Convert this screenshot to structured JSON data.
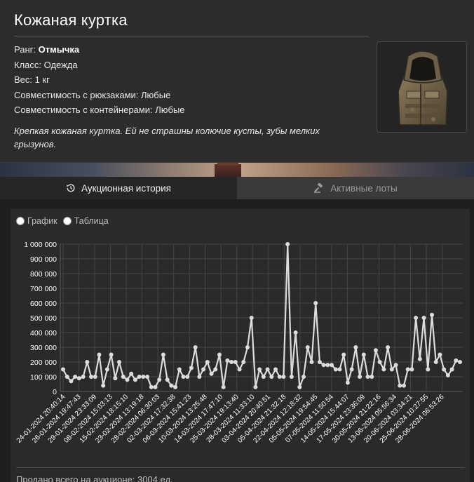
{
  "item": {
    "title": "Кожаная куртка",
    "rank_label": "Ранг: ",
    "rank_value": "Отмычка",
    "class_line": "Класс: Одежда",
    "weight_line": "Вес: 1 кг",
    "backpack_line": "Совместимость с рюкзаками: Любые",
    "container_line": "Совместимость с контейнерами: Любые",
    "description": "Крепкая кожаная куртка. Ей не страшны колючие кусты, зубы мелких грызунов.",
    "image_icon": "leather-jacket-hood-icon"
  },
  "tabs": [
    {
      "label": "Аукционная история",
      "icon": "history-icon",
      "active": true
    },
    {
      "label": "Активные лоты",
      "icon": "gavel-icon",
      "active": false
    }
  ],
  "view_options": {
    "graph_label": "График",
    "table_label": "Таблица"
  },
  "colors": {
    "line": "#dcdcdc",
    "grid": "#454545",
    "tick_text": "#ffffff"
  },
  "footer": {
    "sold_text": "Продано всего на аукционе: 3004 ед."
  },
  "chart_data": {
    "type": "line",
    "title": "",
    "xlabel": "",
    "ylabel": "",
    "ylim": [
      0,
      1000000
    ],
    "y_ticks": [
      "0",
      "100 000",
      "200 000",
      "300 000",
      "400 000",
      "500 000",
      "600 000",
      "700 000",
      "800 000",
      "900 000",
      "1 000 000"
    ],
    "x_tick_labels": [
      "24-01-2024 20:40:14",
      "26-01-2024 19:47:43",
      "29-01-2024 23:33:09",
      "08-02-2024 15:03:13",
      "15-02-2024 18:15:10",
      "23-02-2024 13:19:18",
      "28-02-2024 06:30:03",
      "02-03-2024 17:32:38",
      "06-03-2024 15:41:23",
      "10-03-2024 13:25:48",
      "14-03-2024 17:47:10",
      "25-03-2024 19:13:40",
      "28-03-2024 11:33:10",
      "03-04-2024 20:40:51",
      "05-04-2024 21:32:18",
      "22-04-2024 12:18:32",
      "05-05-2024 19:54:45",
      "07-05-2024 11:50:54",
      "14-05-2024 15:44:07",
      "17-05-2024 23:36:09",
      "30-05-2024 21:22:16",
      "13-06-2024 05:56:34",
      "20-06-2024 03:34:21",
      "25-06-2024 10:27:55",
      "28-06-2024 06:53:26"
    ],
    "grid": true,
    "values": [
      150000,
      100000,
      70000,
      100000,
      90000,
      100000,
      200000,
      100000,
      100000,
      250000,
      40000,
      150000,
      250000,
      90000,
      200000,
      100000,
      80000,
      120000,
      80000,
      100000,
      100000,
      100000,
      30000,
      30000,
      80000,
      250000,
      80000,
      40000,
      30000,
      150000,
      100000,
      100000,
      160000,
      300000,
      100000,
      150000,
      200000,
      120000,
      150000,
      250000,
      30000,
      210000,
      200000,
      200000,
      150000,
      200000,
      300000,
      500000,
      30000,
      150000,
      100000,
      150000,
      100000,
      150000,
      100000,
      100000,
      1000000,
      100000,
      400000,
      30000,
      100000,
      300000,
      200000,
      600000,
      200000,
      180000,
      180000,
      180000,
      150000,
      150000,
      250000,
      60000,
      150000,
      300000,
      100000,
      250000,
      100000,
      100000,
      280000,
      200000,
      150000,
      300000,
      150000,
      180000,
      40000,
      40000,
      150000,
      150000,
      500000,
      220000,
      500000,
      150000,
      520000,
      200000,
      250000,
      150000,
      110000,
      150000,
      210000,
      200000
    ]
  }
}
